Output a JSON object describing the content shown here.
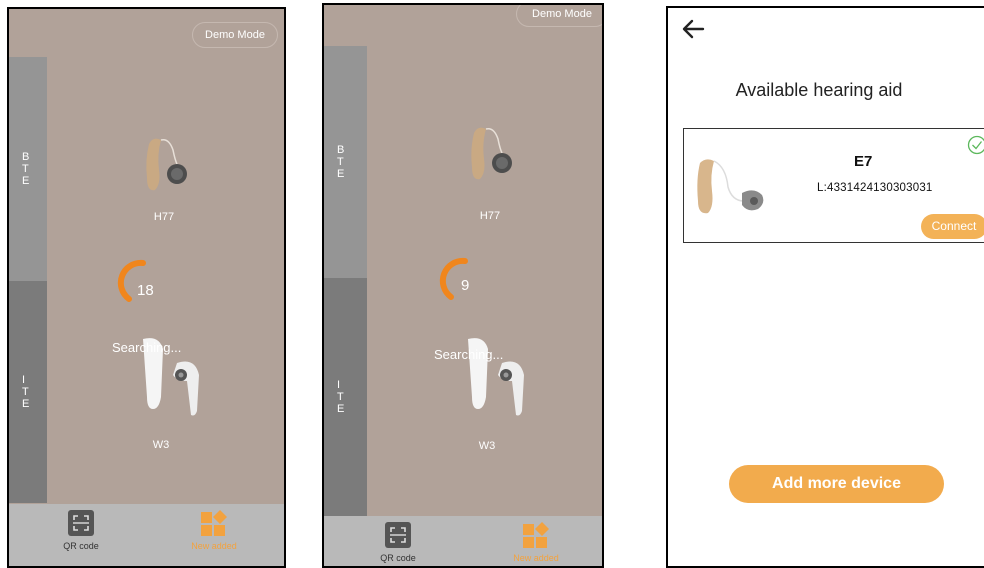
{
  "screens": [
    {
      "demo_mode": "Demo Mode",
      "tab_bte": [
        "B",
        "T",
        "E"
      ],
      "tab_ite": [
        "I",
        "T",
        "E"
      ],
      "device_bte_name": "H77",
      "device_ite_name": "W3",
      "countdown": "18",
      "status": "Searching...",
      "nav": {
        "qr": "QR code",
        "new": "New added"
      }
    },
    {
      "demo_mode": "Demo Mode",
      "tab_bte": [
        "B",
        "T",
        "E"
      ],
      "tab_ite": [
        "I",
        "T",
        "E"
      ],
      "device_bte_name": "H77",
      "device_ite_name": "W3",
      "countdown": "9",
      "status": "Searching...",
      "nav": {
        "qr": "QR code",
        "new": "New added"
      }
    }
  ],
  "results": {
    "title": "Available hearing aid",
    "device": {
      "name": "E7",
      "id": "L:4331424130303031",
      "connect_label": "Connect"
    },
    "add_more_label": "Add more device"
  },
  "colors": {
    "screen_bg": "#b1a299",
    "accent_orange": "#f2a23f",
    "check_green": "#5cb85c"
  }
}
